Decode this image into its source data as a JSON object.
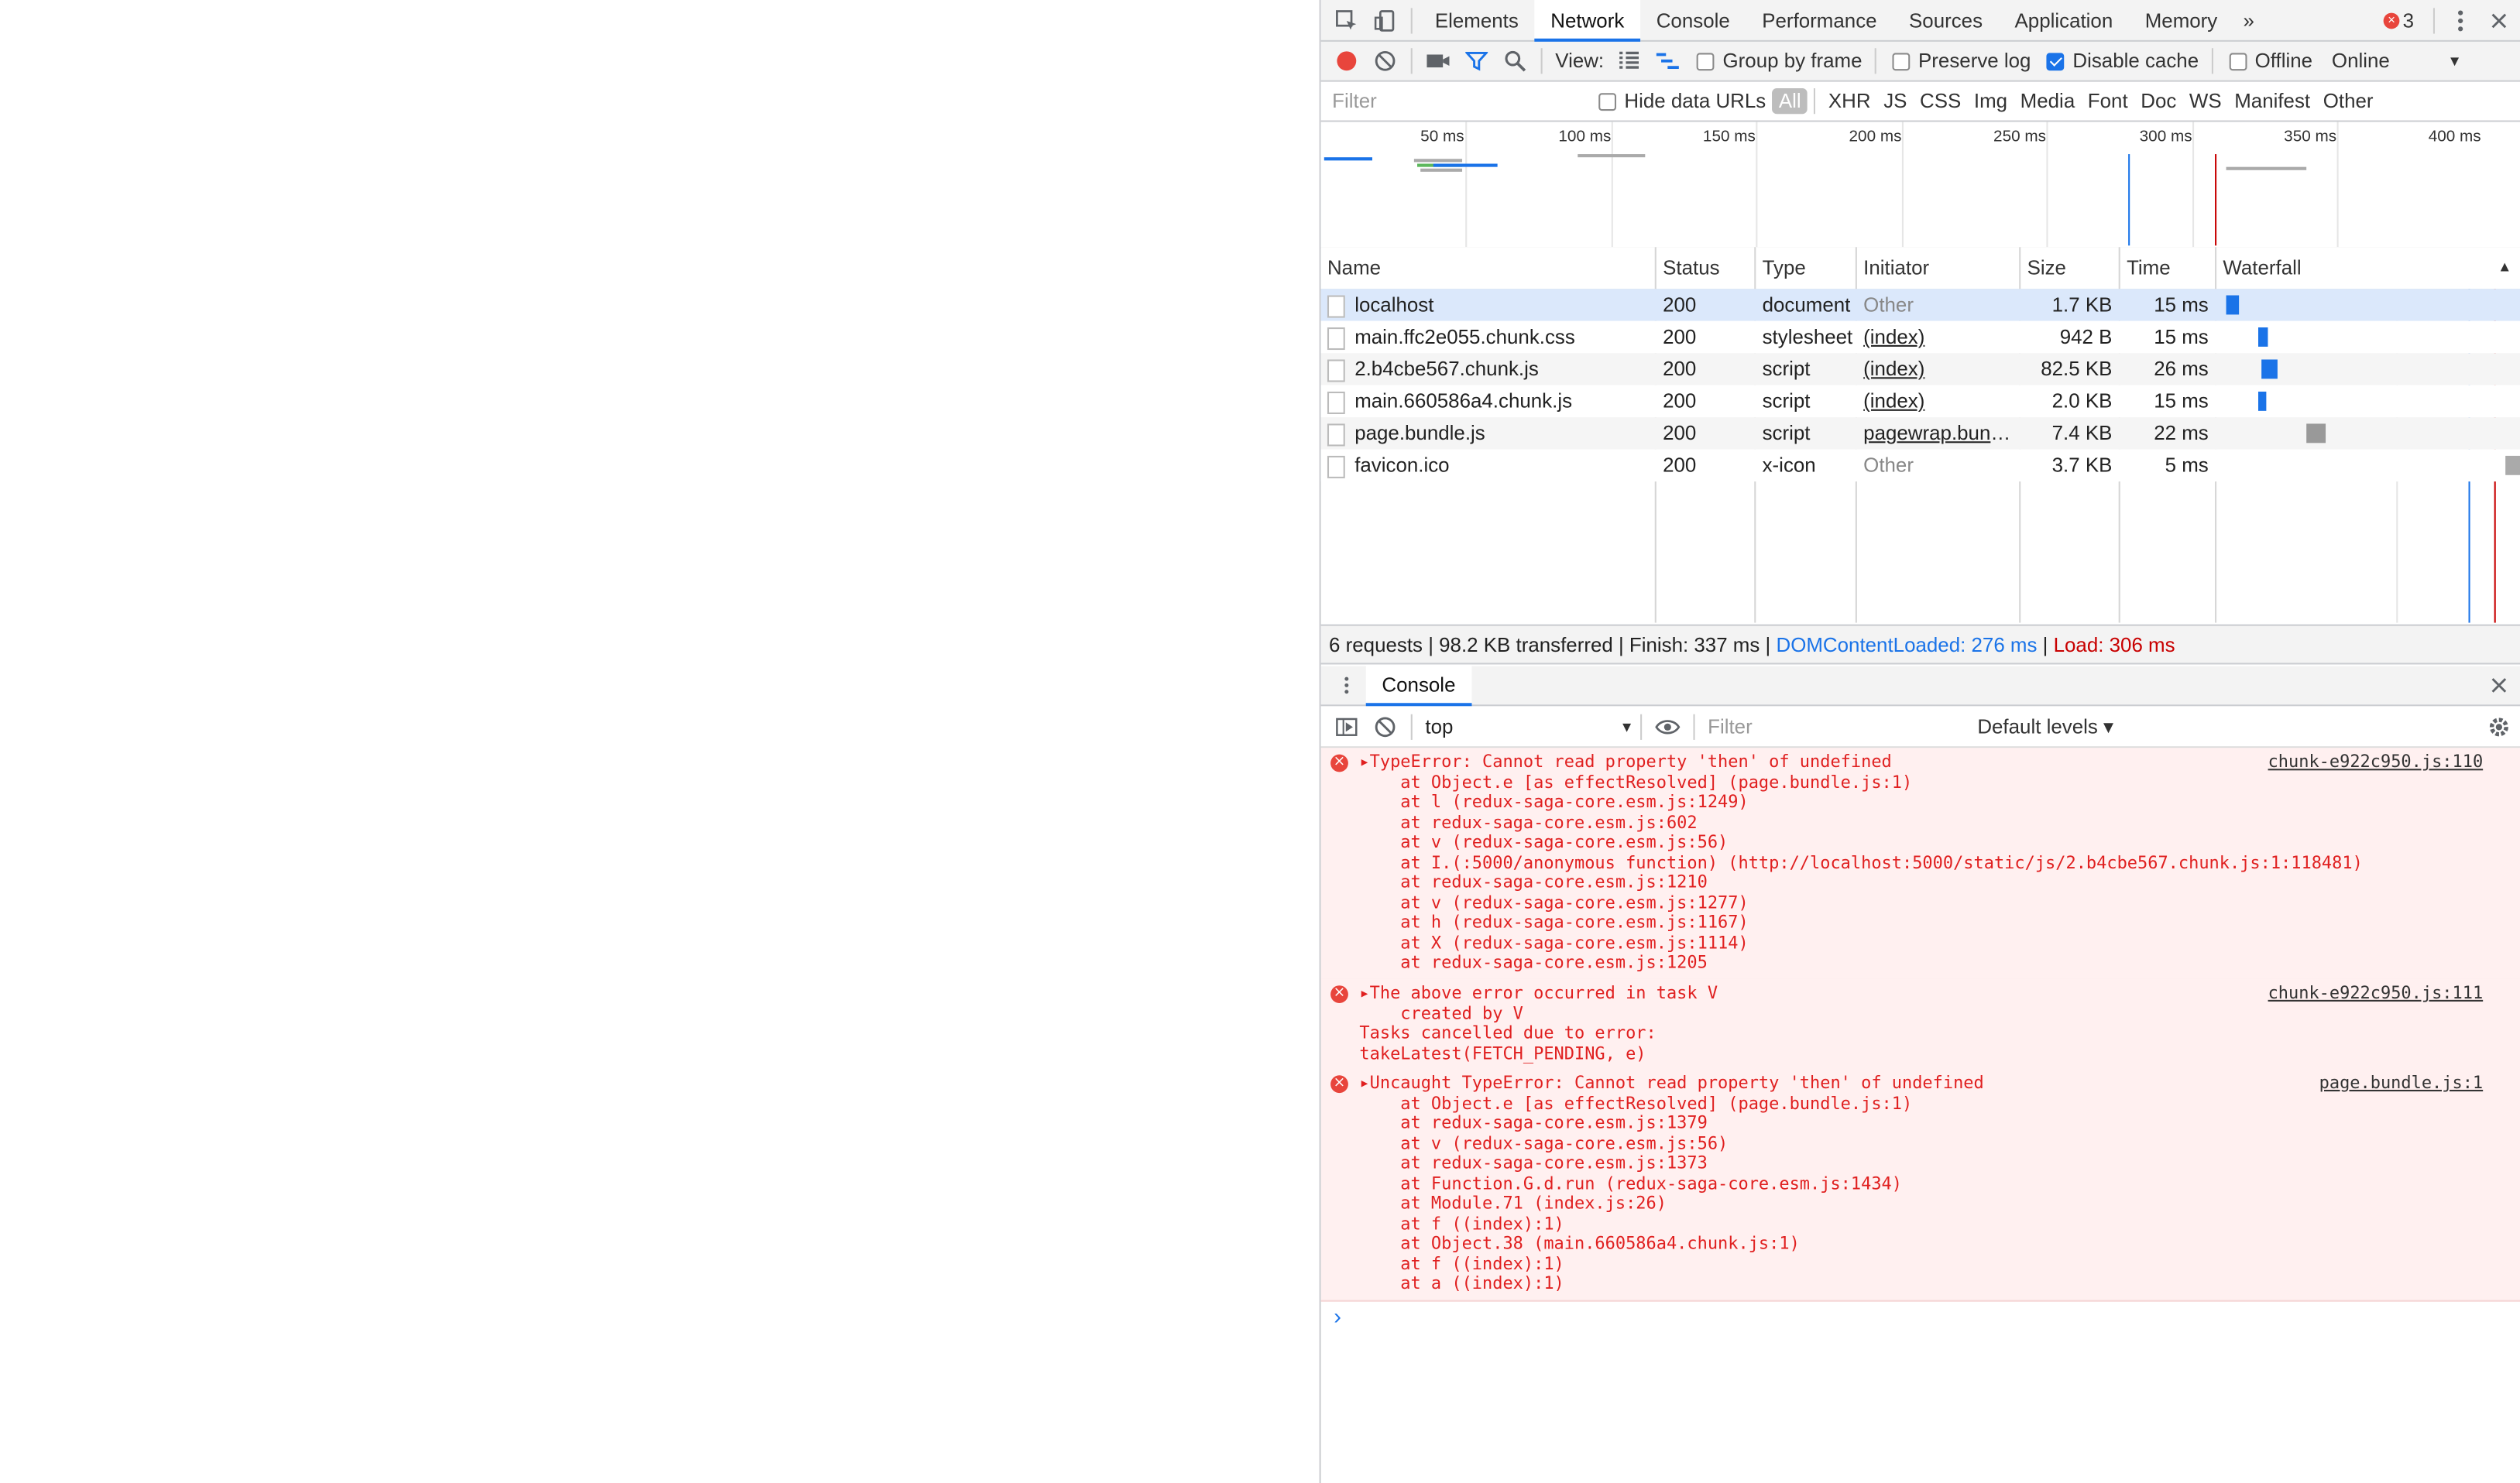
{
  "tabs": {
    "items": [
      "Elements",
      "Network",
      "Console",
      "Performance",
      "Sources",
      "Application",
      "Memory"
    ],
    "more": "»",
    "error_count": "3"
  },
  "toolbar": {
    "view_label": "View:",
    "group_by_frame": "Group by frame",
    "preserve_log": "Preserve log",
    "disable_cache": "Disable cache",
    "offline": "Offline",
    "throttle": "Online"
  },
  "filterbar": {
    "placeholder": "Filter",
    "hide_data_urls": "Hide data URLs",
    "types": [
      "All",
      "XHR",
      "JS",
      "CSS",
      "Img",
      "Media",
      "Font",
      "Doc",
      "WS",
      "Manifest",
      "Other"
    ]
  },
  "overview": {
    "ticks": [
      "50 ms",
      "100 ms",
      "150 ms",
      "200 ms",
      "250 ms",
      "300 ms",
      "350 ms",
      "400 ms"
    ]
  },
  "table": {
    "headers": [
      "Name",
      "Status",
      "Type",
      "Initiator",
      "Size",
      "Time",
      "Waterfall"
    ],
    "rows": [
      {
        "name": "localhost",
        "status": "200",
        "type": "document",
        "initiator": "Other",
        "size": "1.7 KB",
        "time": "15 ms"
      },
      {
        "name": "main.ffc2e055.chunk.css",
        "status": "200",
        "type": "stylesheet",
        "initiator": "(index)",
        "size": "942 B",
        "time": "15 ms"
      },
      {
        "name": "2.b4cbe567.chunk.js",
        "status": "200",
        "type": "script",
        "initiator": "(index)",
        "size": "82.5 KB",
        "time": "26 ms"
      },
      {
        "name": "main.660586a4.chunk.js",
        "status": "200",
        "type": "script",
        "initiator": "(index)",
        "size": "2.0 KB",
        "time": "15 ms"
      },
      {
        "name": "page.bundle.js",
        "status": "200",
        "type": "script",
        "initiator": "pagewrap.bundle.js",
        "size": "7.4 KB",
        "time": "22 ms"
      },
      {
        "name": "favicon.ico",
        "status": "200",
        "type": "x-icon",
        "initiator": "Other",
        "size": "3.7 KB",
        "time": "5 ms"
      }
    ]
  },
  "summary": {
    "main": "6 requests | 98.2 KB transferred | Finish: 337 ms | ",
    "dcl": "DOMContentLoaded: 276 ms",
    "sep": " | ",
    "load": "Load: 306 ms"
  },
  "drawer": {
    "title": "Console"
  },
  "console": {
    "context": "top",
    "filter_placeholder": "Filter",
    "levels": "Default levels ▾",
    "messages": [
      {
        "source": "chunk-e922c950.js:110",
        "lines": [
          "▸TypeError: Cannot read property 'then' of undefined",
          "    at Object.e [as effectResolved] (page.bundle.js:1)",
          "    at l (redux-saga-core.esm.js:1249)",
          "    at redux-saga-core.esm.js:602",
          "    at v (redux-saga-core.esm.js:56)",
          "    at I.(:5000/anonymous function) (http://localhost:5000/static/js/2.b4cbe567.chunk.js:1:118481)",
          "    at redux-saga-core.esm.js:1210",
          "    at v (redux-saga-core.esm.js:1277)",
          "    at h (redux-saga-core.esm.js:1167)",
          "    at X (redux-saga-core.esm.js:1114)",
          "    at redux-saga-core.esm.js:1205"
        ]
      },
      {
        "source": "chunk-e922c950.js:111",
        "lines": [
          "▸The above error occurred in task V",
          "    created by V",
          "Tasks cancelled due to error:",
          "takeLatest(FETCH_PENDING, e)"
        ]
      },
      {
        "source": "page.bundle.js:1",
        "lines": [
          "▸Uncaught TypeError: Cannot read property 'then' of undefined",
          "    at Object.e [as effectResolved] (page.bundle.js:1)",
          "    at redux-saga-core.esm.js:1379",
          "    at v (redux-saga-core.esm.js:56)",
          "    at redux-saga-core.esm.js:1373",
          "    at Function.G.d.run (redux-saga-core.esm.js:1434)",
          "    at Module.71 (index.js:26)",
          "    at f ((index):1)",
          "    at Object.38 (main.660586a4.chunk.js:1)",
          "    at f ((index):1)",
          "    at a ((index):1)"
        ]
      }
    ],
    "prompt": "›"
  },
  "colors": {
    "accent": "#1a73e8",
    "error": "#e02020",
    "dcl": "#1a73e8",
    "load": "#c80000"
  }
}
